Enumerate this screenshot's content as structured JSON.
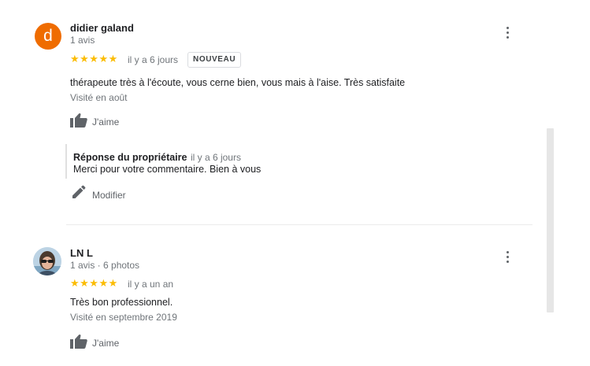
{
  "reviews": [
    {
      "avatar_letter": "d",
      "avatar_color": "#ef6c00",
      "name": "didier galand",
      "meta": "1 avis",
      "stars": "★★★★★",
      "rating": 5,
      "time": "il y a 6 jours",
      "badge": "NOUVEAU",
      "text": "thérapeute très à l'écoute, vous cerne bien, vous mais à l'aise. Très satisfaite",
      "visited": "Visité en août",
      "like_label": "J'aime",
      "reply": {
        "owner_label": "Réponse du propriétaire",
        "time": "il y a 6 jours",
        "text": "Merci pour votre commentaire. Bien à vous"
      },
      "edit_label": "Modifier"
    },
    {
      "name": "LN L",
      "meta": "1 avis · 6 photos",
      "stars": "★★★★★",
      "rating": 5,
      "time": "il y a un an",
      "text": "Très bon professionnel.",
      "visited": "Visité en septembre 2019",
      "like_label": "J'aime"
    }
  ],
  "colors": {
    "star": "#fbbc04",
    "secondary_text": "#70757a",
    "icon": "#5f6368"
  },
  "icons": [
    "more-vert-icon",
    "thumb-up-icon",
    "pencil-icon"
  ]
}
